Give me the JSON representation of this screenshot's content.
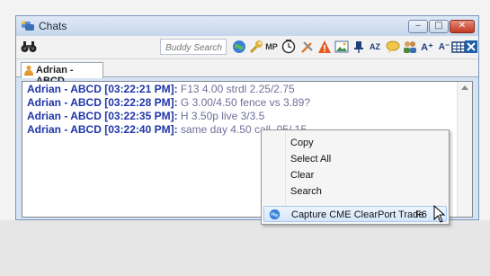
{
  "window": {
    "title": "Chats",
    "min_symbol": "‒",
    "max_symbol": "□",
    "close_symbol": "✕"
  },
  "toolbar": {
    "search_placeholder": "Buddy Search",
    "icons": [
      "find-icon",
      "globe-icon",
      "wrench-icon",
      "mp-icon",
      "clock-icon",
      "tools-icon",
      "warning-icon",
      "picture-icon",
      "pin-icon",
      "sort-icon",
      "chat-bubble-icon",
      "users-icon",
      "font-increase-icon",
      "font-decrease-icon",
      "grid-icon",
      "excel-icon"
    ],
    "mp_label": "MP",
    "sort_label": "AZ",
    "font_up_label": "A⁺",
    "font_down_label": "A⁻"
  },
  "tab": {
    "label": "Adrian - ABCD"
  },
  "chat": {
    "messages": [
      {
        "sender": "Adrian - ABCD [03:22:21 PM]:",
        "text": " F13 4.00 strdl 2.25/2.75"
      },
      {
        "sender": "Adrian - ABCD [03:22:28 PM]:",
        "text": " G 3.00/4.50 fence vs 3.89?"
      },
      {
        "sender": "Adrian - ABCD [03:22:35 PM]:",
        "text": " H 3.50p live 3/3.5"
      },
      {
        "sender": "Adrian - ABCD [03:22:40 PM]:",
        "text": " same day 4.50 call .05/.15"
      }
    ]
  },
  "context_menu": {
    "items": [
      {
        "label": "Copy"
      },
      {
        "label": "Select All"
      },
      {
        "label": "Clear"
      },
      {
        "label": "Search"
      },
      {
        "label": "Capture CME ClearPort Trade",
        "shortcut": "F6"
      }
    ]
  },
  "colors": {
    "sender": "#1f35a8",
    "message": "#6f6f9a",
    "titlebar": "#c6d7ec",
    "close_button": "#c43b23"
  }
}
